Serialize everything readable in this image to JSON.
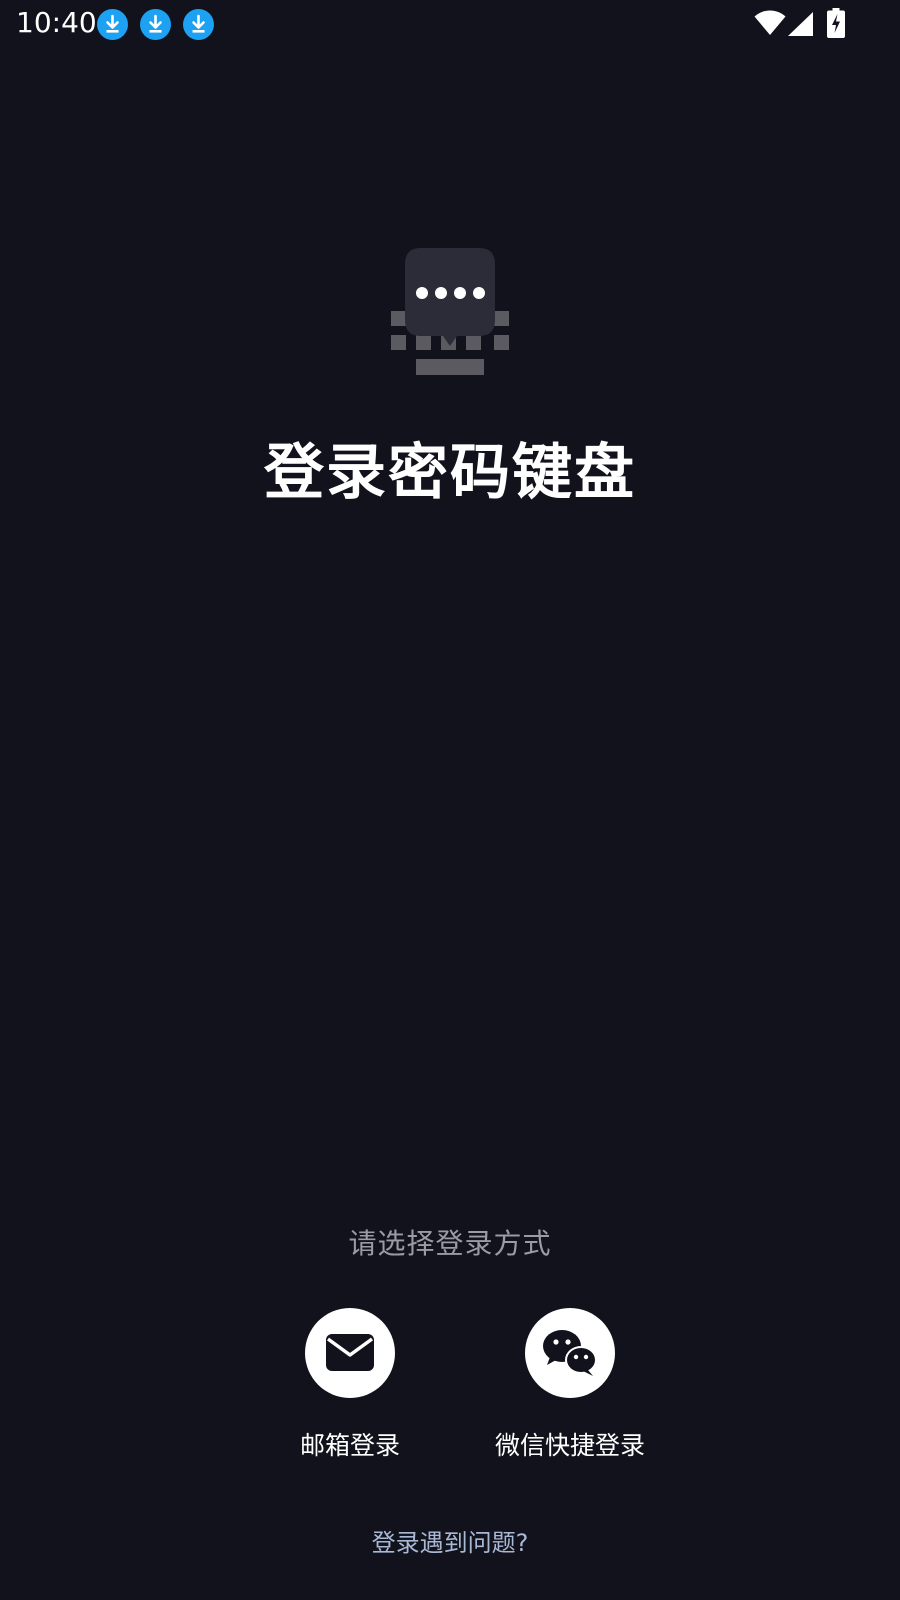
{
  "status_bar": {
    "time": "10:40",
    "notification_icons": [
      "download-icon",
      "download-icon",
      "download-icon"
    ],
    "right_icons": [
      "wifi-icon",
      "cellular-signal-icon",
      "battery-charging-icon"
    ]
  },
  "app": {
    "logo_icon": "keyboard-password-icon",
    "title": "登录密码键盘"
  },
  "login": {
    "prompt": "请选择登录方式",
    "options": [
      {
        "icon": "envelope-icon",
        "label": "邮箱登录"
      },
      {
        "icon": "wechat-icon",
        "label": "微信快捷登录"
      }
    ],
    "problem_link": "登录遇到问题?"
  },
  "colors": {
    "background": "#12121d",
    "accent_download": "#1da1f2",
    "muted_text": "#9a9ba6",
    "link_text": "#a9b8d4"
  }
}
